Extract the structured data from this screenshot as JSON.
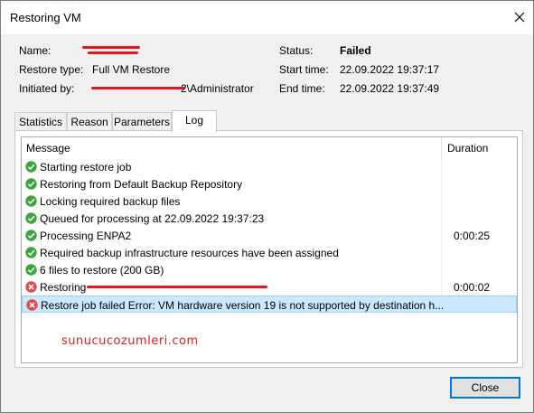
{
  "window": {
    "title": "Restoring VM"
  },
  "info": {
    "name_label": "Name:",
    "restore_type_label": "Restore type:",
    "restore_type_value": "Full VM Restore",
    "initiated_by_label": "Initiated by:",
    "initiated_by_value": "2\\Administrator",
    "status_label": "Status:",
    "status_value": "Failed",
    "start_time_label": "Start time:",
    "start_time_value": "22.09.2022 19:37:17",
    "end_time_label": "End time:",
    "end_time_value": "22.09.2022 19:37:49"
  },
  "tabs": [
    {
      "label": "Statistics"
    },
    {
      "label": "Reason"
    },
    {
      "label": "Parameters"
    },
    {
      "label": "Log",
      "active": true
    }
  ],
  "log": {
    "columns": {
      "message": "Message",
      "duration": "Duration"
    },
    "rows": [
      {
        "message": "Starting restore job",
        "duration": "",
        "status": "success"
      },
      {
        "message": "Restoring from Default Backup Repository",
        "duration": "",
        "status": "success"
      },
      {
        "message": "Locking required backup files",
        "duration": "",
        "status": "success"
      },
      {
        "message": "Queued for processing at 22.09.2022 19:37:23",
        "duration": "",
        "status": "success"
      },
      {
        "message": "Processing ENPA2",
        "duration": "0:00:25",
        "status": "success"
      },
      {
        "message": "Required backup infrastructure resources have been assigned",
        "duration": "",
        "status": "success"
      },
      {
        "message": "6 files to restore (200 GB)",
        "duration": "",
        "status": "success"
      },
      {
        "message": "Restoring",
        "duration": "0:00:02",
        "status": "error"
      },
      {
        "message": "Restore job failed Error: VM hardware version 19 is not supported by destination h...",
        "duration": "",
        "status": "error",
        "selected": true
      }
    ]
  },
  "watermark": "sunucucozumleri.com",
  "buttons": {
    "close": "Close"
  },
  "colors": {
    "success": "#3aa53a",
    "error": "#e04b4b",
    "selection": "#cce8ff",
    "accent": "#0078d7",
    "watermark": "#d42020"
  }
}
